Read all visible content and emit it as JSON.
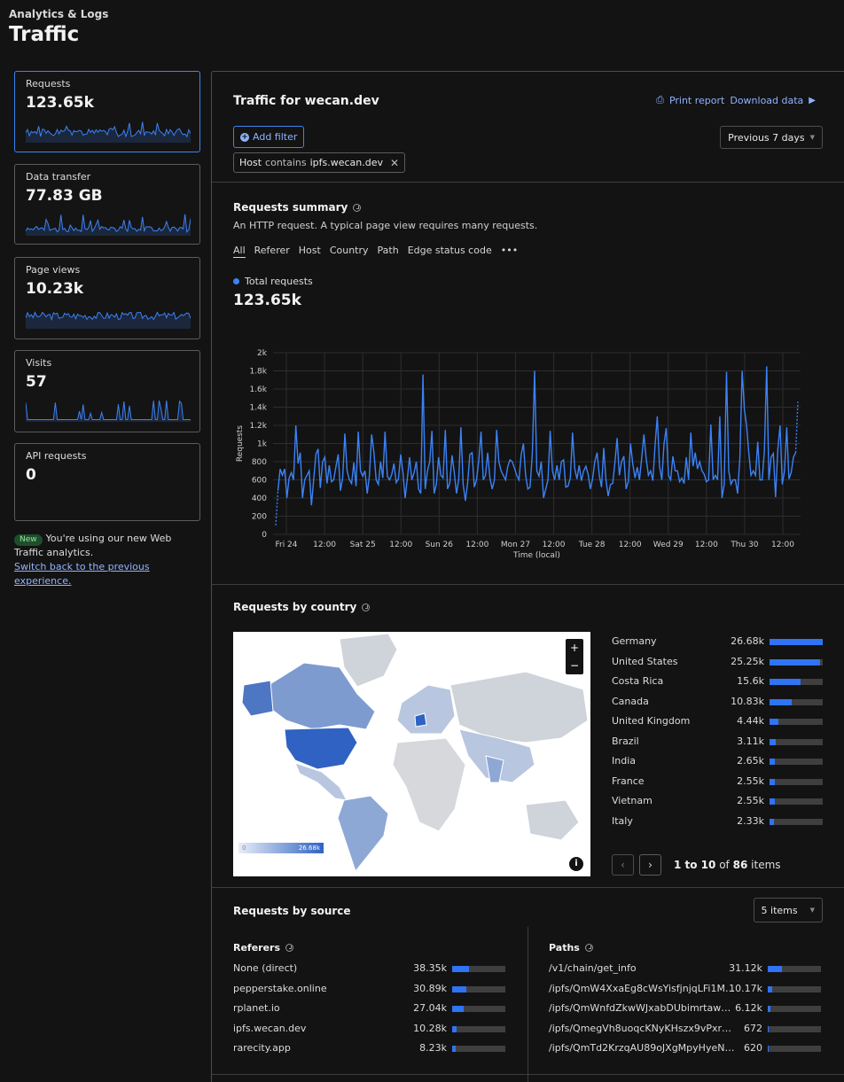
{
  "header": {
    "subtitle": "Analytics & Logs",
    "title": "Traffic"
  },
  "sidebar": {
    "cards": [
      {
        "label": "Requests",
        "value": "123.65k",
        "active": true
      },
      {
        "label": "Data transfer",
        "value": "77.83 GB",
        "active": false
      },
      {
        "label": "Page views",
        "value": "10.23k",
        "active": false
      },
      {
        "label": "Visits",
        "value": "57",
        "active": false
      },
      {
        "label": "API requests",
        "value": "0",
        "active": false
      }
    ],
    "notice": {
      "badge": "New",
      "text": "You're using our new Web Traffic analytics.",
      "link": "Switch back to the previous experience."
    }
  },
  "panel": {
    "title": "Traffic for wecan.dev",
    "print_report": "Print report",
    "download_data": "Download data",
    "add_filter": "Add filter",
    "date_range": "Previous 7 days",
    "filter_chip": {
      "field": "Host",
      "operator": "contains",
      "value": "ipfs.wecan.dev"
    }
  },
  "summary": {
    "title": "Requests summary",
    "description": "An HTTP request. A typical page view requires many requests.",
    "tabs": [
      "All",
      "Referer",
      "Host",
      "Country",
      "Path",
      "Edge status code",
      "•••"
    ],
    "active_tab": "All",
    "legend_label": "Total requests",
    "total": "123.65k"
  },
  "chart_data": {
    "type": "line",
    "ylabel": "Requests",
    "xlabel": "Time (local)",
    "ylim": [
      0,
      2000
    ],
    "y_ticks": [
      "0",
      "200",
      "400",
      "600",
      "800",
      "1k",
      "1.2k",
      "1.4k",
      "1.6k",
      "1.8k",
      "2k"
    ],
    "x_ticks": [
      "Fri 24",
      "12:00",
      "Sat 25",
      "12:00",
      "Sun 26",
      "12:00",
      "Mon 27",
      "12:00",
      "Tue 28",
      "12:00",
      "Wed 29",
      "12:00",
      "Thu 30",
      "12:00"
    ],
    "grid": true,
    "series": [
      {
        "values": [
          100,
          480,
          720,
          650,
          720,
          400,
          620,
          680,
          600,
          1200,
          780,
          900,
          400,
          600,
          650,
          700,
          320,
          600,
          880,
          940,
          510,
          800,
          850,
          560,
          760,
          580,
          600,
          750,
          880,
          480,
          620,
          1110,
          700,
          600,
          560,
          790,
          530,
          1130,
          700,
          640,
          700,
          450,
          650,
          1100,
          900,
          600,
          550,
          800,
          620,
          1130,
          640,
          600,
          660,
          780,
          570,
          610,
          880,
          680,
          400,
          620,
          850,
          600,
          680,
          800,
          500,
          450,
          1760,
          500,
          700,
          800,
          1140,
          450,
          550,
          850,
          650,
          620,
          1150,
          500,
          560,
          870,
          680,
          450,
          600,
          1180,
          550,
          370,
          570,
          880,
          900,
          520,
          600,
          820,
          1130,
          600,
          650,
          900,
          620,
          500,
          600,
          1150,
          800,
          700,
          650,
          600,
          750,
          820,
          800,
          730,
          650,
          600,
          880,
          1000,
          650,
          500,
          520,
          900,
          1800,
          700,
          640,
          800,
          400,
          500,
          600,
          1140,
          700,
          600,
          760,
          600,
          800,
          820,
          520,
          530,
          620,
          1120,
          720,
          610,
          760,
          590,
          700,
          750,
          660,
          500,
          610,
          800,
          900,
          650,
          520,
          950,
          600,
          420,
          550,
          560,
          790,
          1060,
          650,
          800,
          860,
          500,
          580,
          1000,
          780,
          620,
          740,
          600,
          840,
          1100,
          840,
          650,
          700,
          590,
          980,
          1300,
          750,
          600,
          1000,
          1170,
          650,
          600,
          860,
          700,
          700,
          580,
          620,
          560,
          850,
          600,
          1120,
          750,
          900,
          720,
          800,
          700,
          660,
          580,
          600,
          1210,
          600,
          650,
          600,
          1300,
          400,
          550,
          1790,
          700,
          550,
          600,
          600,
          450,
          850,
          1800,
          1380,
          1200,
          900,
          650,
          700,
          650,
          1020,
          600,
          600,
          920,
          1850,
          600,
          850,
          890,
          410,
          930,
          1200,
          550,
          700,
          1180,
          610,
          680,
          850,
          900,
          1460
        ],
        "dashed_ends": true
      }
    ]
  },
  "country": {
    "title": "Requests by country",
    "map_legend_max": "26.68k",
    "map_legend_min": "0",
    "rows": [
      {
        "name": "Germany",
        "value": "26.68k",
        "fraction": 1.0
      },
      {
        "name": "United States",
        "value": "25.25k",
        "fraction": 0.95
      },
      {
        "name": "Costa Rica",
        "value": "15.6k",
        "fraction": 0.58
      },
      {
        "name": "Canada",
        "value": "10.83k",
        "fraction": 0.41
      },
      {
        "name": "United Kingdom",
        "value": "4.44k",
        "fraction": 0.17
      },
      {
        "name": "Brazil",
        "value": "3.11k",
        "fraction": 0.12
      },
      {
        "name": "India",
        "value": "2.65k",
        "fraction": 0.1
      },
      {
        "name": "France",
        "value": "2.55k",
        "fraction": 0.1
      },
      {
        "name": "Vietnam",
        "value": "2.55k",
        "fraction": 0.1
      },
      {
        "name": "Italy",
        "value": "2.33k",
        "fraction": 0.09
      }
    ],
    "pagination": {
      "range": "1 to 10",
      "of": "of",
      "total": "86",
      "suffix": "items"
    }
  },
  "source": {
    "title": "Requests by source",
    "items_select": "5 items",
    "referers_title": "Referers",
    "paths_title": "Paths",
    "referers": [
      {
        "name": "None (direct)",
        "value": "38.35k",
        "fraction": 0.32
      },
      {
        "name": "pepperstake.online",
        "value": "30.89k",
        "fraction": 0.26
      },
      {
        "name": "rplanet.io",
        "value": "27.04k",
        "fraction": 0.22
      },
      {
        "name": "ipfs.wecan.dev",
        "value": "10.28k",
        "fraction": 0.09
      },
      {
        "name": "rarecity.app",
        "value": "8.23k",
        "fraction": 0.07
      }
    ],
    "paths": [
      {
        "name": "/v1/chain/get_info",
        "value": "31.12k",
        "fraction": 0.26
      },
      {
        "name": "/ipfs/QmW4XxaEg8cWsYisfjnjqLFi1Mb…",
        "value": "10.17k",
        "fraction": 0.09
      },
      {
        "name": "/ipfs/QmWnfdZkwWJxabDUbimrtaweYF…",
        "value": "6.12k",
        "fraction": 0.05
      },
      {
        "name": "/ipfs/QmegVh8uoqcKNyKHszx9vPxrH77g…",
        "value": "672",
        "fraction": 0.01
      },
      {
        "name": "/ipfs/QmTd2KrzqAU89oJXgMpyHyeN1oh…",
        "value": "620",
        "fraction": 0.01
      }
    ]
  },
  "colors": {
    "accent": "#3b82f6",
    "link": "#8db2ff",
    "bar": "#2f74f5",
    "bar_bg": "#3f3f3f"
  }
}
